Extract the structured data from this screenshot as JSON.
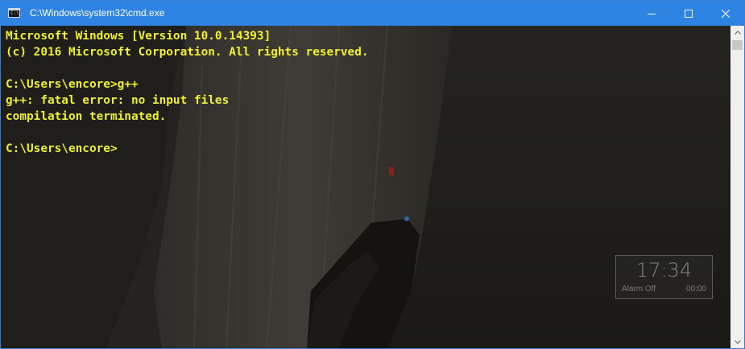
{
  "window": {
    "title": "C:\\Windows\\system32\\cmd.exe",
    "titlebar_color": "#2f83e2",
    "controls": [
      "minimize-icon",
      "maximize-icon",
      "close-icon"
    ]
  },
  "console": {
    "text_color": "#f0f032",
    "lines": [
      "Microsoft Windows [Version 10.0.14393]",
      "(c) 2016 Microsoft Corporation. All rights reserved.",
      "",
      "C:\\Users\\encore>g++",
      "g++: fatal error: no input files",
      "compilation terminated.",
      "",
      "C:\\Users\\encore>"
    ]
  },
  "clock_widget": {
    "time": "17:34",
    "alarm": "Alarm Off",
    "timer": "00:00"
  },
  "app_icon": {
    "prompt": "C:\\_"
  }
}
